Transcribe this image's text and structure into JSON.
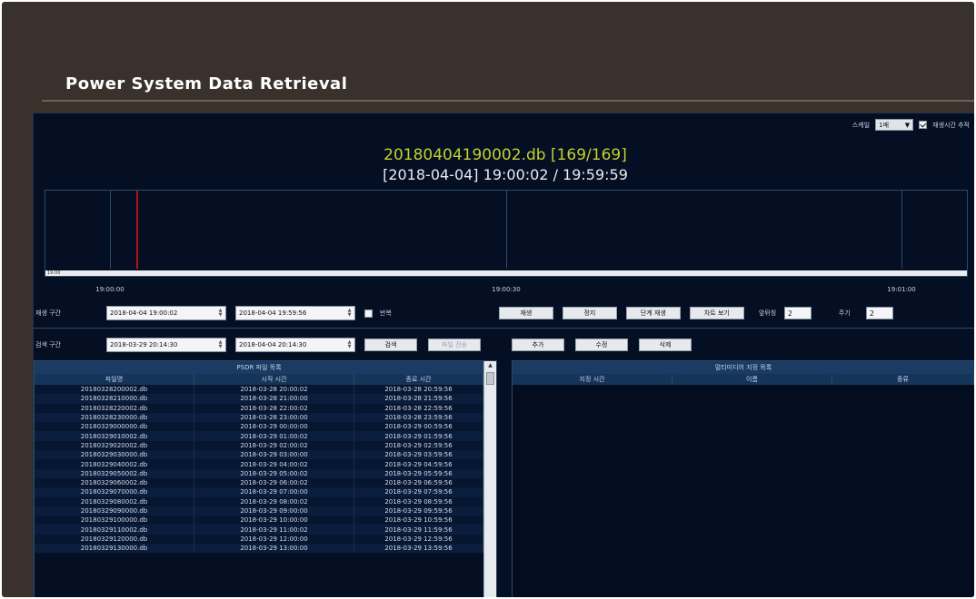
{
  "app": {
    "title": "Power System Data Retrieval"
  },
  "topbar": {
    "scale_label": "스케일",
    "scale_value": "1배",
    "follow_label": "재생시간 추적",
    "follow_checked": true
  },
  "header": {
    "file": "20180404190002.db [169/169]",
    "time": "[2018-04-04] 19:00:02 / 19:59:59"
  },
  "timeline": {
    "bar_label": "19:00",
    "ticks": [
      "19:00:00",
      "19:00:30",
      "19:01:00"
    ],
    "cursor_time": "19:00:02"
  },
  "play": {
    "label": "재생 구간",
    "start": "2018-04-04 19:00:02",
    "end": "2018-04-04 19:59:56",
    "repeat_label": "반복",
    "buttons": [
      "재생",
      "정지",
      "단계 재생",
      "차트 보기"
    ],
    "interval_label": "앞뒤칭",
    "interval_value": "2",
    "cycle_label": "주기",
    "cycle_value": "2"
  },
  "search": {
    "label": "검색 구간",
    "start": "2018-03-29 20:14:30",
    "end": "2018-04-04 20:14:30",
    "search_button": "검색",
    "download_button": "파일 전송",
    "buttons": [
      "추가",
      "수정",
      "삭제"
    ]
  },
  "file_list": {
    "title": "PSDR 파일 목록",
    "columns": [
      "파일명",
      "시작 시간",
      "종료 시간"
    ],
    "rows": [
      [
        "20180328200002.db",
        "2018-03-28 20:00:02",
        "2018-03-28 20:59:56"
      ],
      [
        "20180328210000.db",
        "2018-03-28 21:00:00",
        "2018-03-28 21:59:56"
      ],
      [
        "20180328220002.db",
        "2018-03-28 22:00:02",
        "2018-03-28 22:59:56"
      ],
      [
        "20180328230000.db",
        "2018-03-28 23:00:00",
        "2018-03-28 23:59:56"
      ],
      [
        "20180329000000.db",
        "2018-03-29 00:00:00",
        "2018-03-29 00:59:56"
      ],
      [
        "20180329010002.db",
        "2018-03-29 01:00:02",
        "2018-03-29 01:59:56"
      ],
      [
        "20180329020002.db",
        "2018-03-29 02:00:02",
        "2018-03-29 02:59:56"
      ],
      [
        "20180329030000.db",
        "2018-03-29 03:00:00",
        "2018-03-29 03:59:56"
      ],
      [
        "20180329040002.db",
        "2018-03-29 04:00:02",
        "2018-03-29 04:59:56"
      ],
      [
        "20180329050002.db",
        "2018-03-29 05:00:02",
        "2018-03-29 05:59:56"
      ],
      [
        "20180329060002.db",
        "2018-03-29 06:00:02",
        "2018-03-29 06:59:56"
      ],
      [
        "20180329070000.db",
        "2018-03-29 07:00:00",
        "2018-03-29 07:59:56"
      ],
      [
        "20180329080002.db",
        "2018-03-29 08:00:02",
        "2018-03-29 08:59:56"
      ],
      [
        "20180329090000.db",
        "2018-03-29 09:00:00",
        "2018-03-29 09:59:56"
      ],
      [
        "20180329100000.db",
        "2018-03-29 10:00:00",
        "2018-03-29 10:59:56"
      ],
      [
        "20180329110002.db",
        "2018-03-29 11:00:02",
        "2018-03-29 11:59:56"
      ],
      [
        "20180329120000.db",
        "2018-03-29 12:00:00",
        "2018-03-29 12:59:56"
      ],
      [
        "20180329130000.db",
        "2018-03-29 13:00:00",
        "2018-03-29 13:59:56"
      ]
    ]
  },
  "media_list": {
    "title": "멀티미디어 지정 목록",
    "columns": [
      "지정 시간",
      "이름",
      "종류"
    ]
  }
}
